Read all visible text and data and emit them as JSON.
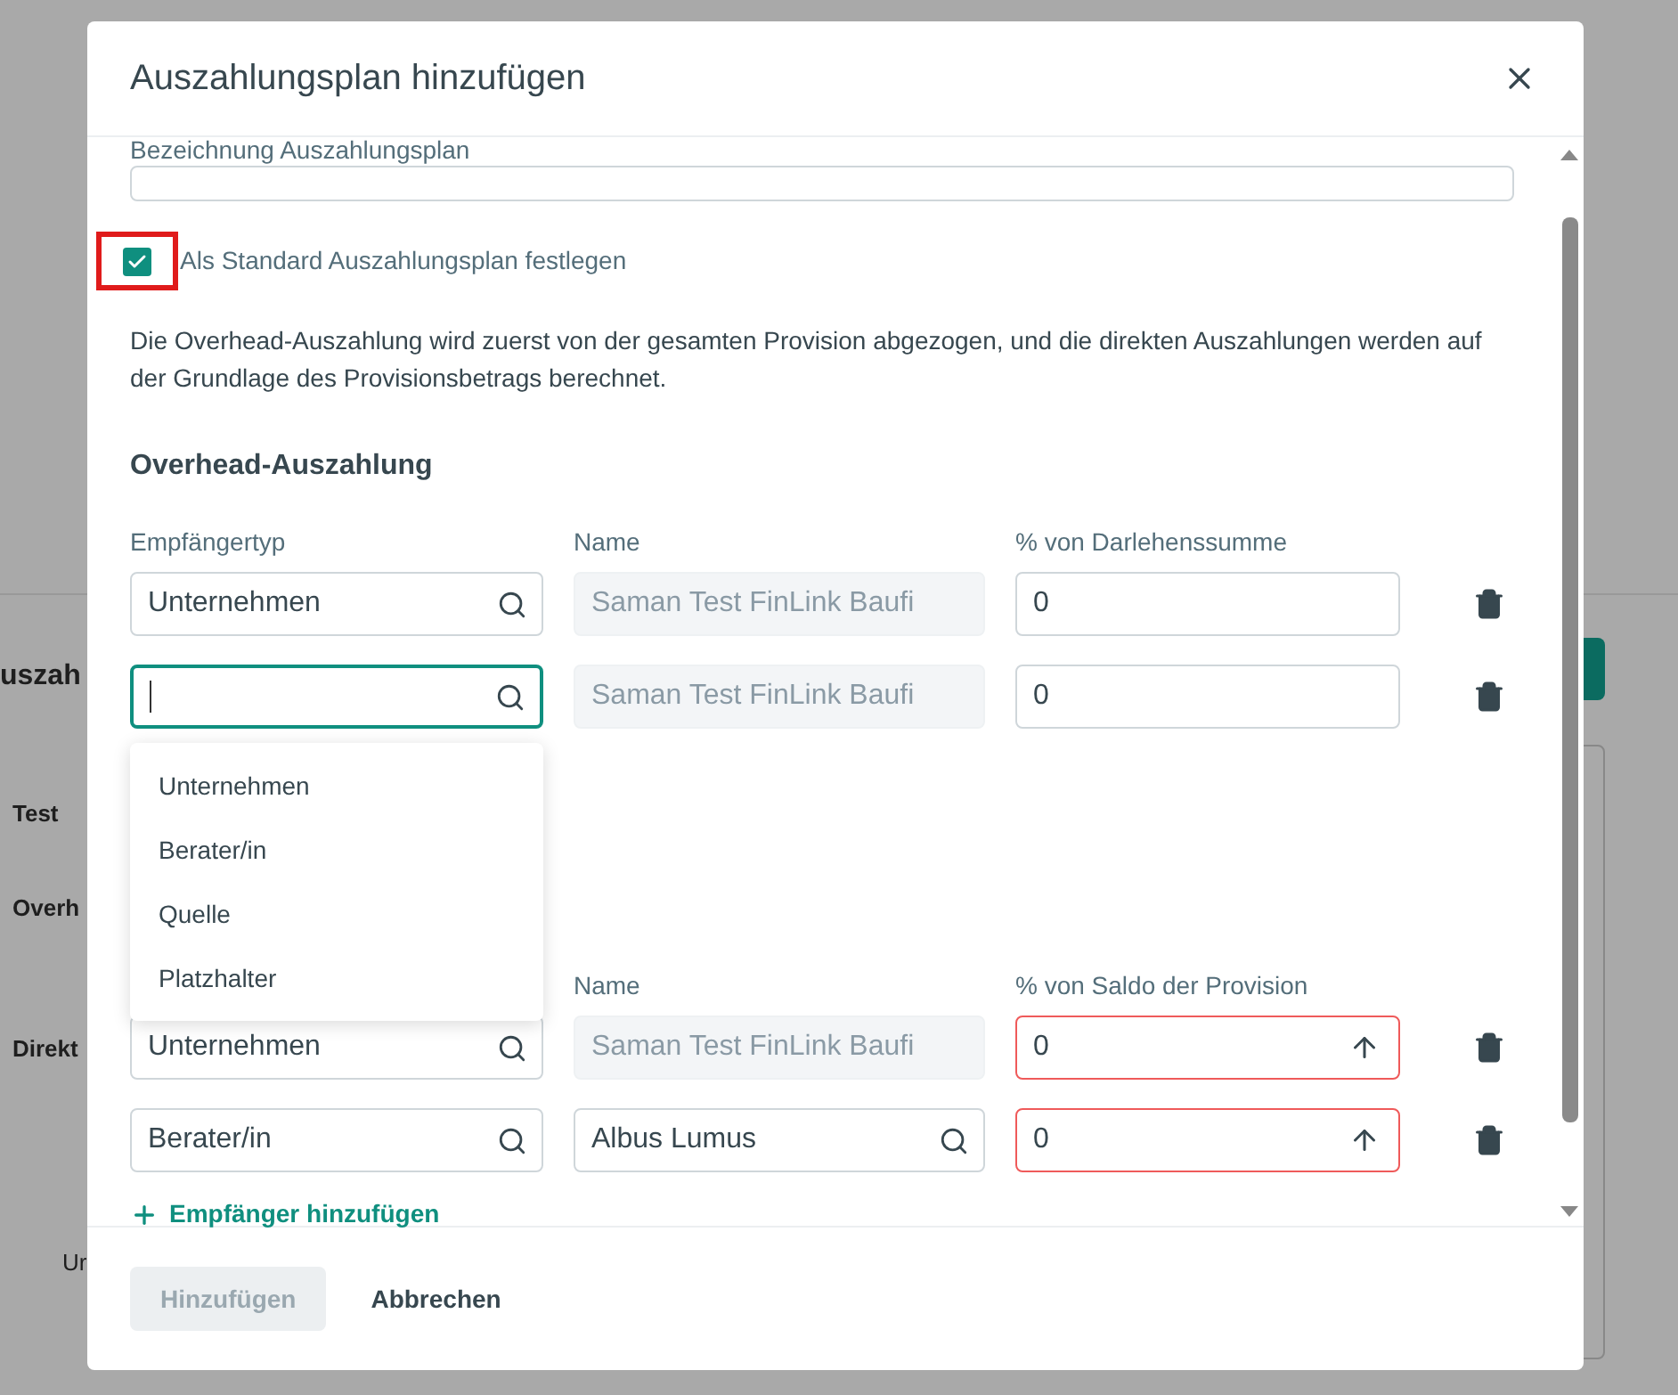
{
  "background": {
    "side_texts": [
      "uszah",
      "Test",
      "Overh",
      "Direkt",
      "Ur"
    ]
  },
  "dialog": {
    "title": "Auszahlungsplan hinzufügen",
    "name_field": {
      "label": "Bezeichnung Auszahlungsplan"
    },
    "default_checkbox": {
      "label": "Als Standard Auszahlungsplan festlegen",
      "checked": true,
      "highlighted": true
    },
    "description": "Die Overhead-Auszahlung wird zuerst von der gesamten Provision abgezogen, und die direkten Auszahlungen werden auf der Grundlage des Provisionsbetrags berechnet.",
    "overhead": {
      "heading": "Overhead-Auszahlung",
      "type_column": "Empfängertyp",
      "name_column": "Name",
      "percent_column": "% von Darlehenssumme",
      "rows": [
        {
          "type": "Unternehmen",
          "name": "Saman Test FinLink Baufi",
          "name_disabled": true,
          "percent": "0",
          "error": false,
          "focused": false
        },
        {
          "name": "Saman Test FinLink Baufi",
          "name_disabled": true,
          "percent": "0",
          "error": false,
          "focused": true
        }
      ]
    },
    "dropdown": {
      "options": [
        "Unternehmen",
        "Berater/in",
        "Quelle",
        "Platzhalter"
      ]
    },
    "direct": {
      "name_column": "Name",
      "percent_column": "% von Saldo der Provision",
      "rows": [
        {
          "type": "Unternehmen",
          "name": "Saman Test FinLink Baufi",
          "name_disabled": true,
          "percent": "0",
          "error": true,
          "focused": false
        },
        {
          "type": "Berater/in",
          "name": "Albus Lumus",
          "name_disabled": false,
          "percent": "0",
          "error": true,
          "focused": false
        }
      ]
    },
    "add_recipient": "Empfänger hinzufügen",
    "buttons": [
      {
        "label": "Hinzufügen",
        "disabled": true
      },
      {
        "label": "Abbrechen",
        "disabled": false
      }
    ]
  }
}
